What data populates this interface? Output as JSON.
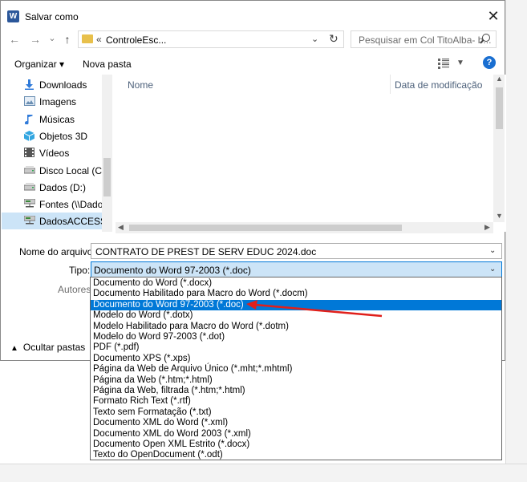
{
  "dialog": {
    "title": "Salvar como",
    "close_label": "✕",
    "app_icon_letter": "W"
  },
  "nav": {
    "back": "←",
    "forward": "→",
    "recent": "⌄",
    "up": "↑"
  },
  "address": {
    "prefix": "«",
    "path": "ControleEsc...",
    "dropdown": "⌄",
    "refresh": "↻"
  },
  "search": {
    "placeholder": "Pesquisar em Col TitoAlba- b..."
  },
  "toolbar": {
    "organize": "Organizar ▾",
    "new_folder": "Nova pasta",
    "help": "?"
  },
  "sidebar": {
    "items": [
      {
        "label": "Downloads",
        "icon": "download-icon",
        "color": "#2f7ad9"
      },
      {
        "label": "Imagens",
        "icon": "image-icon",
        "color": "#6b8fb3"
      },
      {
        "label": "Músicas",
        "icon": "music-icon",
        "color": "#2f7ad9"
      },
      {
        "label": "Objetos 3D",
        "icon": "cube-icon",
        "color": "#33a6e0"
      },
      {
        "label": "Vídeos",
        "icon": "video-icon",
        "color": "#555555"
      },
      {
        "label": "Disco Local (C:)",
        "icon": "drive-icon",
        "color": "#777777"
      },
      {
        "label": "Dados (D:)",
        "icon": "drive-icon",
        "color": "#777777"
      },
      {
        "label": "Fontes (\\\\Dados",
        "icon": "network-drive-icon",
        "color": "#3b8a3b"
      },
      {
        "label": "DadosACCESS (\\",
        "icon": "network-drive-icon",
        "color": "#3b8a3b"
      }
    ]
  },
  "filelist": {
    "col_name": "Nome",
    "col_date": "Data de modificação"
  },
  "form": {
    "filename_label": "Nome do arquivo:",
    "filename_value": "CONTRATO DE PREST DE SERV EDUC 2024.doc",
    "type_label": "Tipo:",
    "type_value": "Documento do Word 97-2003 (*.doc)",
    "authors_label": "Autores:",
    "hide_folders": "Ocultar pastas"
  },
  "dropdown": {
    "selected_index": 2,
    "options": [
      "Documento do Word (*.docx)",
      "Documento Habilitado para Macro do Word (*.docm)",
      "Documento do Word 97-2003 (*.doc)",
      "Modelo do Word (*.dotx)",
      "Modelo Habilitado para Macro do Word (*.dotm)",
      "Modelo do Word 97-2003 (*.dot)",
      "PDF (*.pdf)",
      "Documento XPS (*.xps)",
      "Página da Web de Arquivo Único (*.mht;*.mhtml)",
      "Página da Web (*.htm;*.html)",
      "Página da Web, filtrada (*.htm;*.html)",
      "Formato Rich Text (*.rtf)",
      "Texto sem Formatação (*.txt)",
      "Documento XML do Word (*.xml)",
      "Documento XML do Word 2003 (*.xml)",
      "Documento Open XML Estrito (*.docx)",
      "Texto do OpenDocument (*.odt)"
    ]
  },
  "annotation": {
    "color": "#e0201b"
  }
}
